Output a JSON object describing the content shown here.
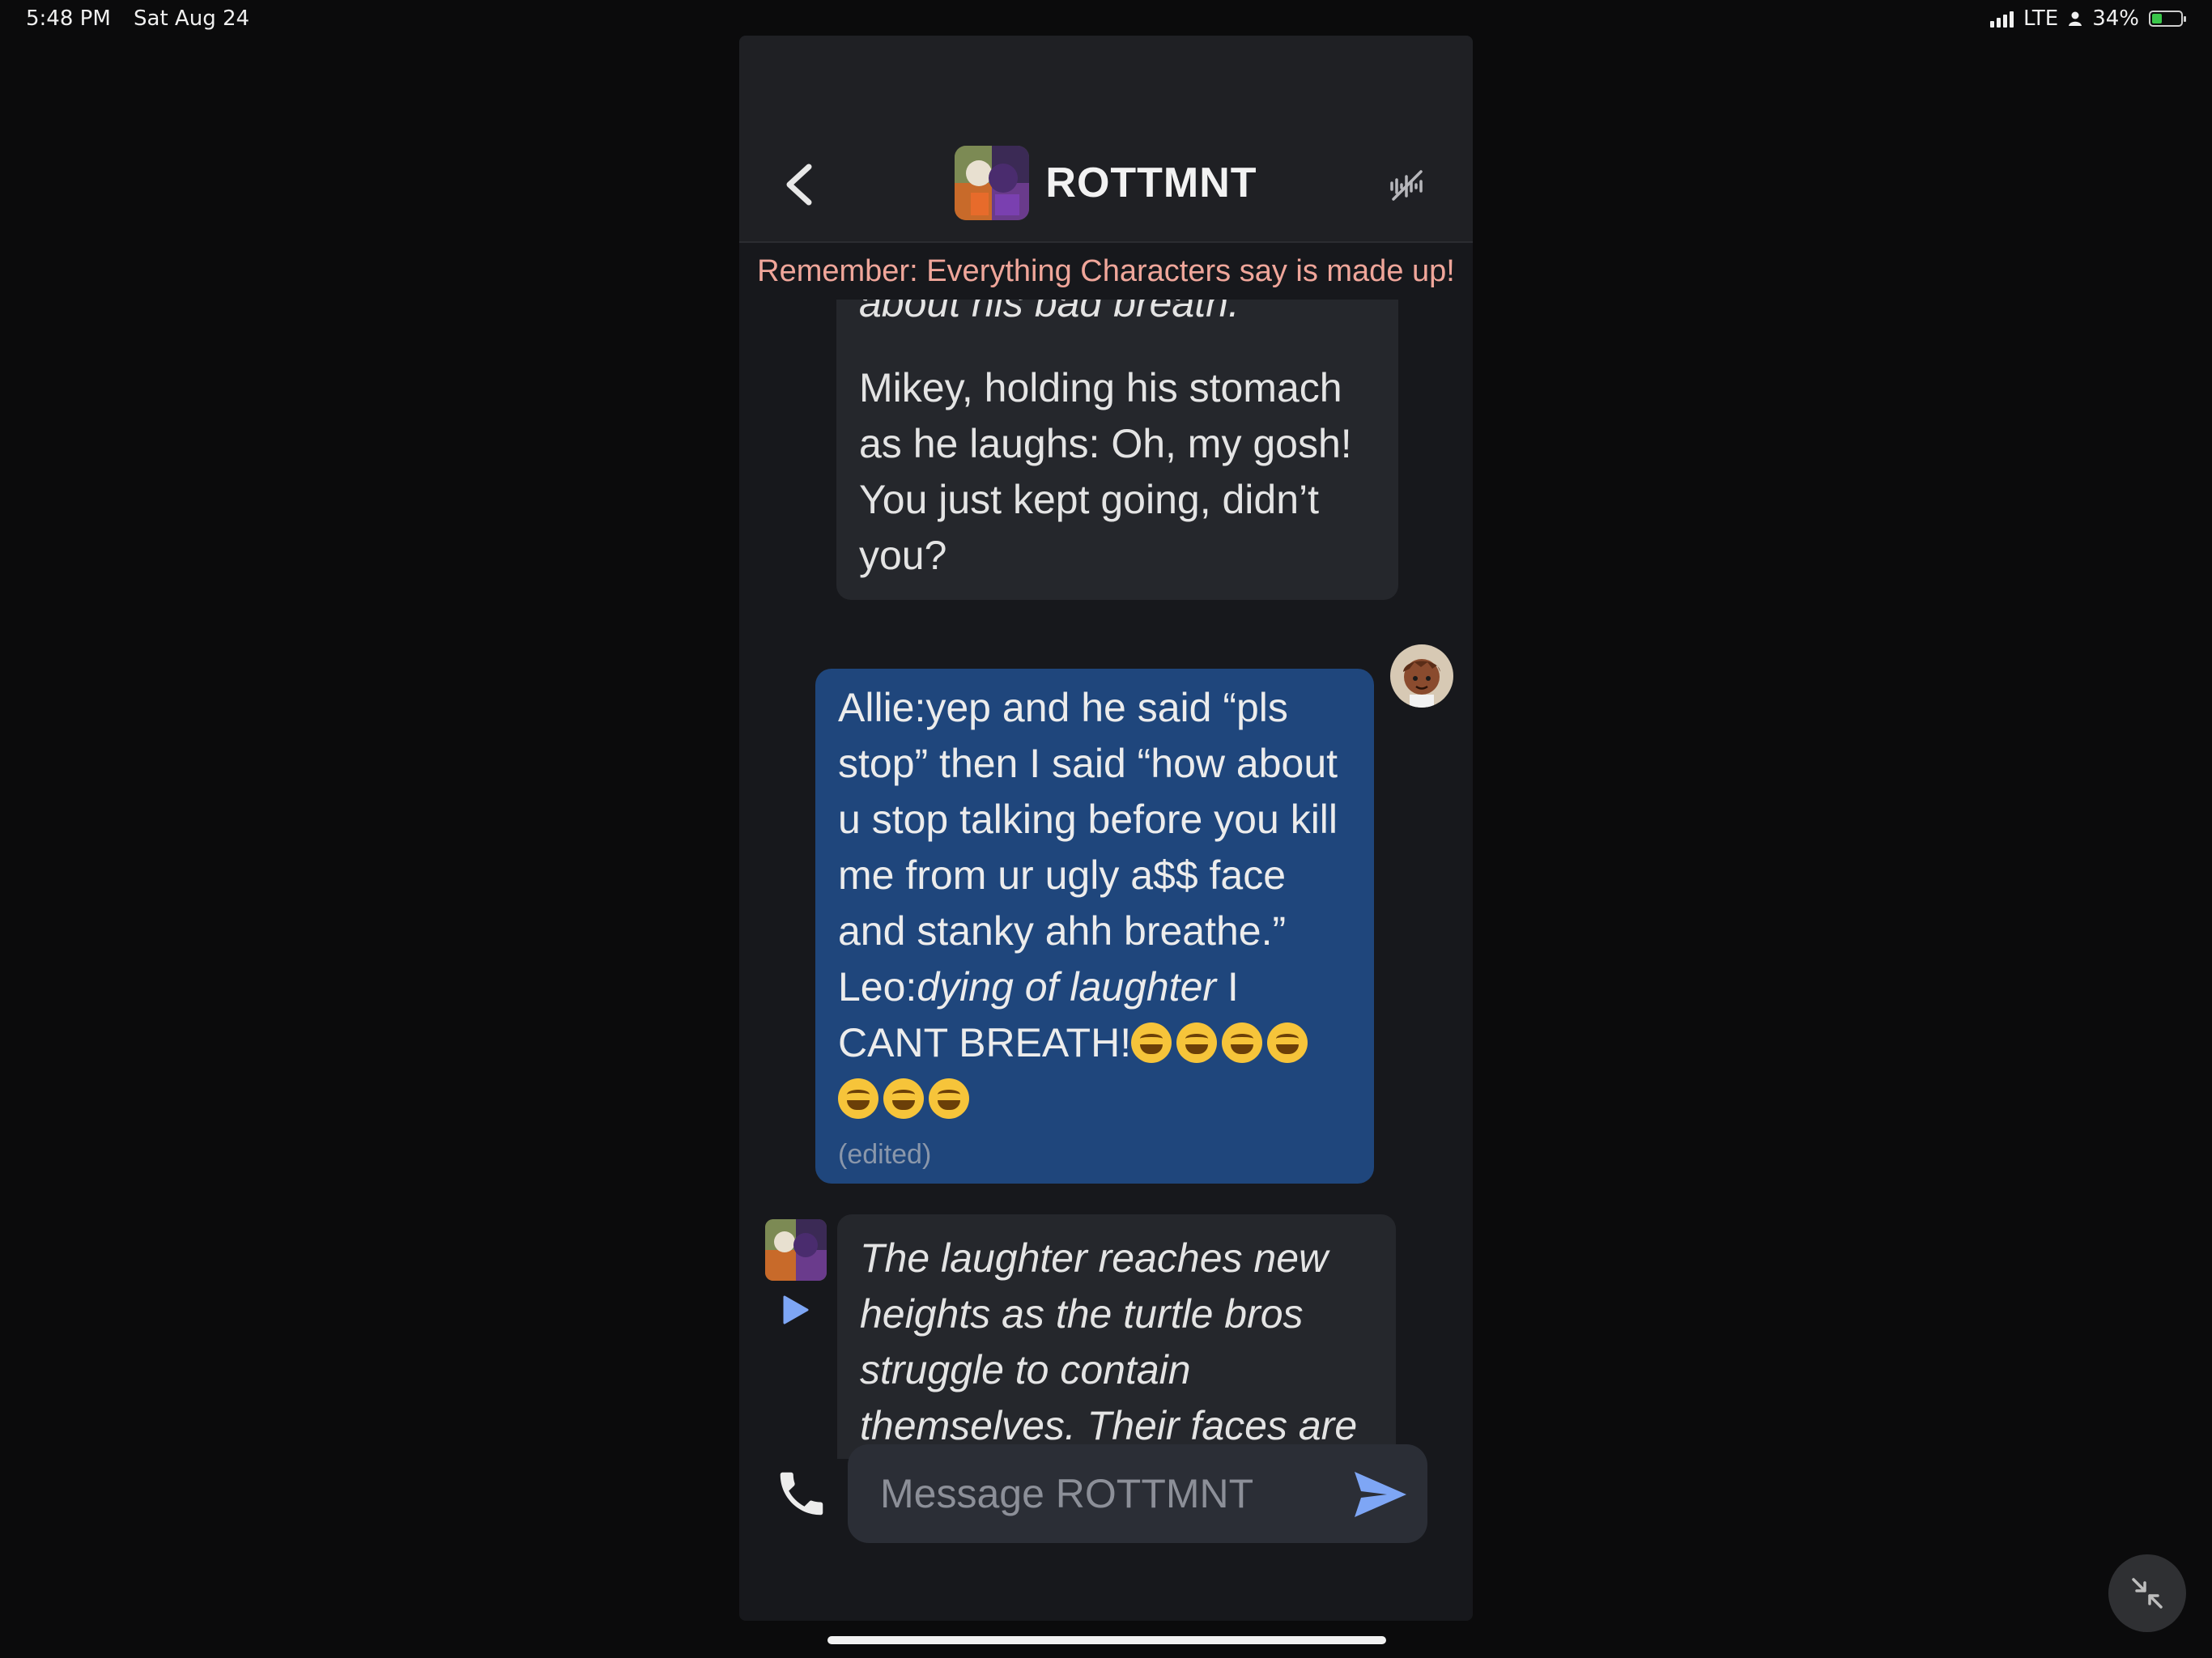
{
  "status_bar": {
    "time": "5:48 PM",
    "date": "Sat Aug 24",
    "network": "LTE",
    "battery": "34%",
    "battery_level": 0.34
  },
  "header": {
    "title": "ROTTMNT"
  },
  "disclaimer": "Remember: Everything Characters say is made up!",
  "messages": [
    {
      "role": "character",
      "text_partial": "about his bad breath.",
      "text": "Mikey, holding his stomach as he laughs: Oh, my gosh! You just kept going, didn’t you?"
    },
    {
      "role": "user",
      "text_before": "Allie:yep and he said “pls stop” then I said “how about u stop talking before you kill me from ur ugly a$$ face and stanky ahh breathe.” Leo:",
      "text_italic": "dying of laughter",
      "text_after": " I CANT BREATH!",
      "emoji_name": "rolling-on-floor-laughing",
      "emoji_count": 7,
      "edited_label": "(edited)"
    },
    {
      "role": "character",
      "text": "The laughter reaches new heights as the turtle bros struggle to contain themselves. Their faces are"
    }
  ],
  "composer": {
    "placeholder": "Message ROTTMNT"
  },
  "colors": {
    "accent": "#7ea6f5",
    "user_bubble": "#1f467c",
    "disclaimer": "#f0a69a",
    "panel": "#17181c"
  },
  "icons": [
    "chevron-left-icon",
    "mute-icon",
    "play-icon",
    "phone-icon",
    "send-icon",
    "minimize-icon"
  ]
}
